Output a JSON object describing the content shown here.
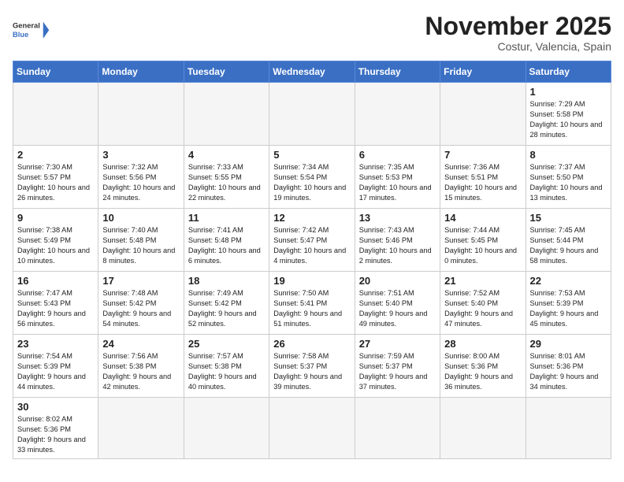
{
  "header": {
    "logo_text_general": "General",
    "logo_text_blue": "Blue",
    "month": "November 2025",
    "location": "Costur, Valencia, Spain"
  },
  "days_of_week": [
    "Sunday",
    "Monday",
    "Tuesday",
    "Wednesday",
    "Thursday",
    "Friday",
    "Saturday"
  ],
  "weeks": [
    [
      {
        "day": "",
        "info": ""
      },
      {
        "day": "",
        "info": ""
      },
      {
        "day": "",
        "info": ""
      },
      {
        "day": "",
        "info": ""
      },
      {
        "day": "",
        "info": ""
      },
      {
        "day": "",
        "info": ""
      },
      {
        "day": "1",
        "info": "Sunrise: 7:29 AM\nSunset: 5:58 PM\nDaylight: 10 hours and 28 minutes."
      }
    ],
    [
      {
        "day": "2",
        "info": "Sunrise: 7:30 AM\nSunset: 5:57 PM\nDaylight: 10 hours and 26 minutes."
      },
      {
        "day": "3",
        "info": "Sunrise: 7:32 AM\nSunset: 5:56 PM\nDaylight: 10 hours and 24 minutes."
      },
      {
        "day": "4",
        "info": "Sunrise: 7:33 AM\nSunset: 5:55 PM\nDaylight: 10 hours and 22 minutes."
      },
      {
        "day": "5",
        "info": "Sunrise: 7:34 AM\nSunset: 5:54 PM\nDaylight: 10 hours and 19 minutes."
      },
      {
        "day": "6",
        "info": "Sunrise: 7:35 AM\nSunset: 5:53 PM\nDaylight: 10 hours and 17 minutes."
      },
      {
        "day": "7",
        "info": "Sunrise: 7:36 AM\nSunset: 5:51 PM\nDaylight: 10 hours and 15 minutes."
      },
      {
        "day": "8",
        "info": "Sunrise: 7:37 AM\nSunset: 5:50 PM\nDaylight: 10 hours and 13 minutes."
      }
    ],
    [
      {
        "day": "9",
        "info": "Sunrise: 7:38 AM\nSunset: 5:49 PM\nDaylight: 10 hours and 10 minutes."
      },
      {
        "day": "10",
        "info": "Sunrise: 7:40 AM\nSunset: 5:48 PM\nDaylight: 10 hours and 8 minutes."
      },
      {
        "day": "11",
        "info": "Sunrise: 7:41 AM\nSunset: 5:48 PM\nDaylight: 10 hours and 6 minutes."
      },
      {
        "day": "12",
        "info": "Sunrise: 7:42 AM\nSunset: 5:47 PM\nDaylight: 10 hours and 4 minutes."
      },
      {
        "day": "13",
        "info": "Sunrise: 7:43 AM\nSunset: 5:46 PM\nDaylight: 10 hours and 2 minutes."
      },
      {
        "day": "14",
        "info": "Sunrise: 7:44 AM\nSunset: 5:45 PM\nDaylight: 10 hours and 0 minutes."
      },
      {
        "day": "15",
        "info": "Sunrise: 7:45 AM\nSunset: 5:44 PM\nDaylight: 9 hours and 58 minutes."
      }
    ],
    [
      {
        "day": "16",
        "info": "Sunrise: 7:47 AM\nSunset: 5:43 PM\nDaylight: 9 hours and 56 minutes."
      },
      {
        "day": "17",
        "info": "Sunrise: 7:48 AM\nSunset: 5:42 PM\nDaylight: 9 hours and 54 minutes."
      },
      {
        "day": "18",
        "info": "Sunrise: 7:49 AM\nSunset: 5:42 PM\nDaylight: 9 hours and 52 minutes."
      },
      {
        "day": "19",
        "info": "Sunrise: 7:50 AM\nSunset: 5:41 PM\nDaylight: 9 hours and 51 minutes."
      },
      {
        "day": "20",
        "info": "Sunrise: 7:51 AM\nSunset: 5:40 PM\nDaylight: 9 hours and 49 minutes."
      },
      {
        "day": "21",
        "info": "Sunrise: 7:52 AM\nSunset: 5:40 PM\nDaylight: 9 hours and 47 minutes."
      },
      {
        "day": "22",
        "info": "Sunrise: 7:53 AM\nSunset: 5:39 PM\nDaylight: 9 hours and 45 minutes."
      }
    ],
    [
      {
        "day": "23",
        "info": "Sunrise: 7:54 AM\nSunset: 5:39 PM\nDaylight: 9 hours and 44 minutes."
      },
      {
        "day": "24",
        "info": "Sunrise: 7:56 AM\nSunset: 5:38 PM\nDaylight: 9 hours and 42 minutes."
      },
      {
        "day": "25",
        "info": "Sunrise: 7:57 AM\nSunset: 5:38 PM\nDaylight: 9 hours and 40 minutes."
      },
      {
        "day": "26",
        "info": "Sunrise: 7:58 AM\nSunset: 5:37 PM\nDaylight: 9 hours and 39 minutes."
      },
      {
        "day": "27",
        "info": "Sunrise: 7:59 AM\nSunset: 5:37 PM\nDaylight: 9 hours and 37 minutes."
      },
      {
        "day": "28",
        "info": "Sunrise: 8:00 AM\nSunset: 5:36 PM\nDaylight: 9 hours and 36 minutes."
      },
      {
        "day": "29",
        "info": "Sunrise: 8:01 AM\nSunset: 5:36 PM\nDaylight: 9 hours and 34 minutes."
      }
    ],
    [
      {
        "day": "30",
        "info": "Sunrise: 8:02 AM\nSunset: 5:36 PM\nDaylight: 9 hours and 33 minutes."
      },
      {
        "day": "",
        "info": ""
      },
      {
        "day": "",
        "info": ""
      },
      {
        "day": "",
        "info": ""
      },
      {
        "day": "",
        "info": ""
      },
      {
        "day": "",
        "info": ""
      },
      {
        "day": "",
        "info": ""
      }
    ]
  ]
}
